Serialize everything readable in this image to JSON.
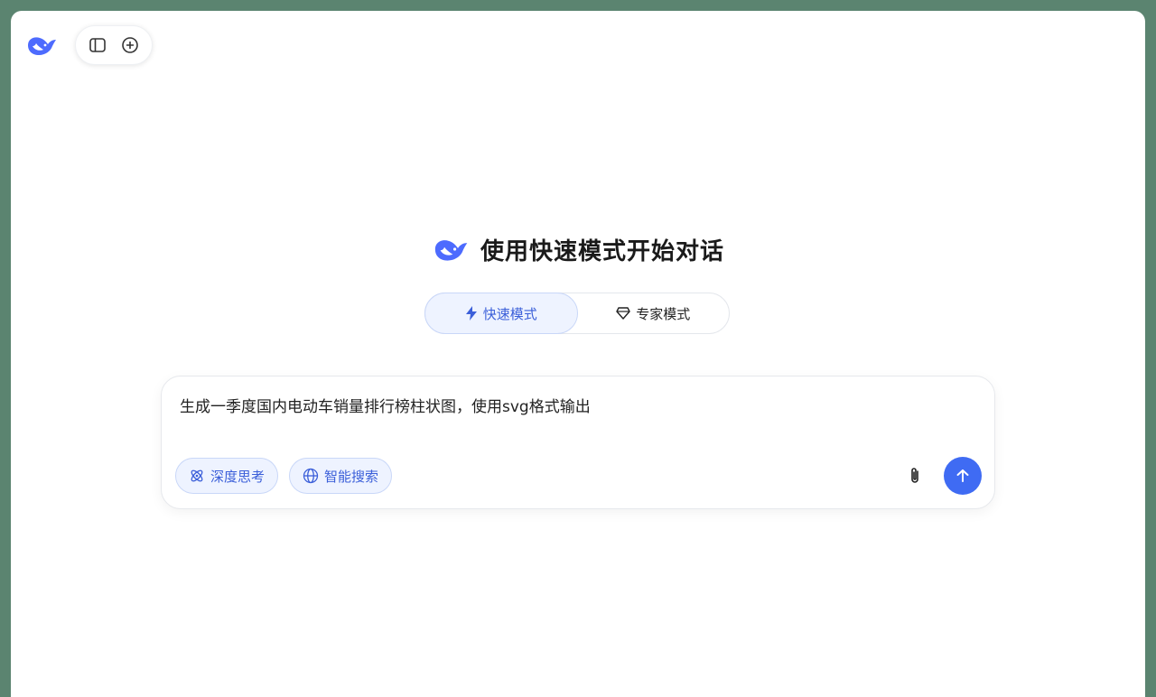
{
  "header": {
    "title": "使用快速模式开始对话"
  },
  "modes": {
    "fast_label": "快速模式",
    "expert_label": "专家模式",
    "selected": "快速模式"
  },
  "chat": {
    "input_value": "生成一季度国内电动车销量排行榜柱状图，使用svg格式输出",
    "deep_think_label": "深度思考",
    "smart_search_label": "智能搜索"
  },
  "icons": {
    "logo": "deepseek-whale-logo",
    "sidebar": "sidebar-toggle-icon",
    "new_chat": "new-chat-icon",
    "fast": "lightning-icon",
    "expert": "diamond-icon",
    "deep_think": "atom-icon",
    "smart_search": "globe-icon",
    "attach": "paperclip-icon",
    "send": "arrow-up-icon"
  },
  "colors": {
    "brand": "#4d6bfe",
    "accent": "#3f6bf3",
    "selected_bg": "#eef3ff",
    "frame": "#5b8470"
  }
}
